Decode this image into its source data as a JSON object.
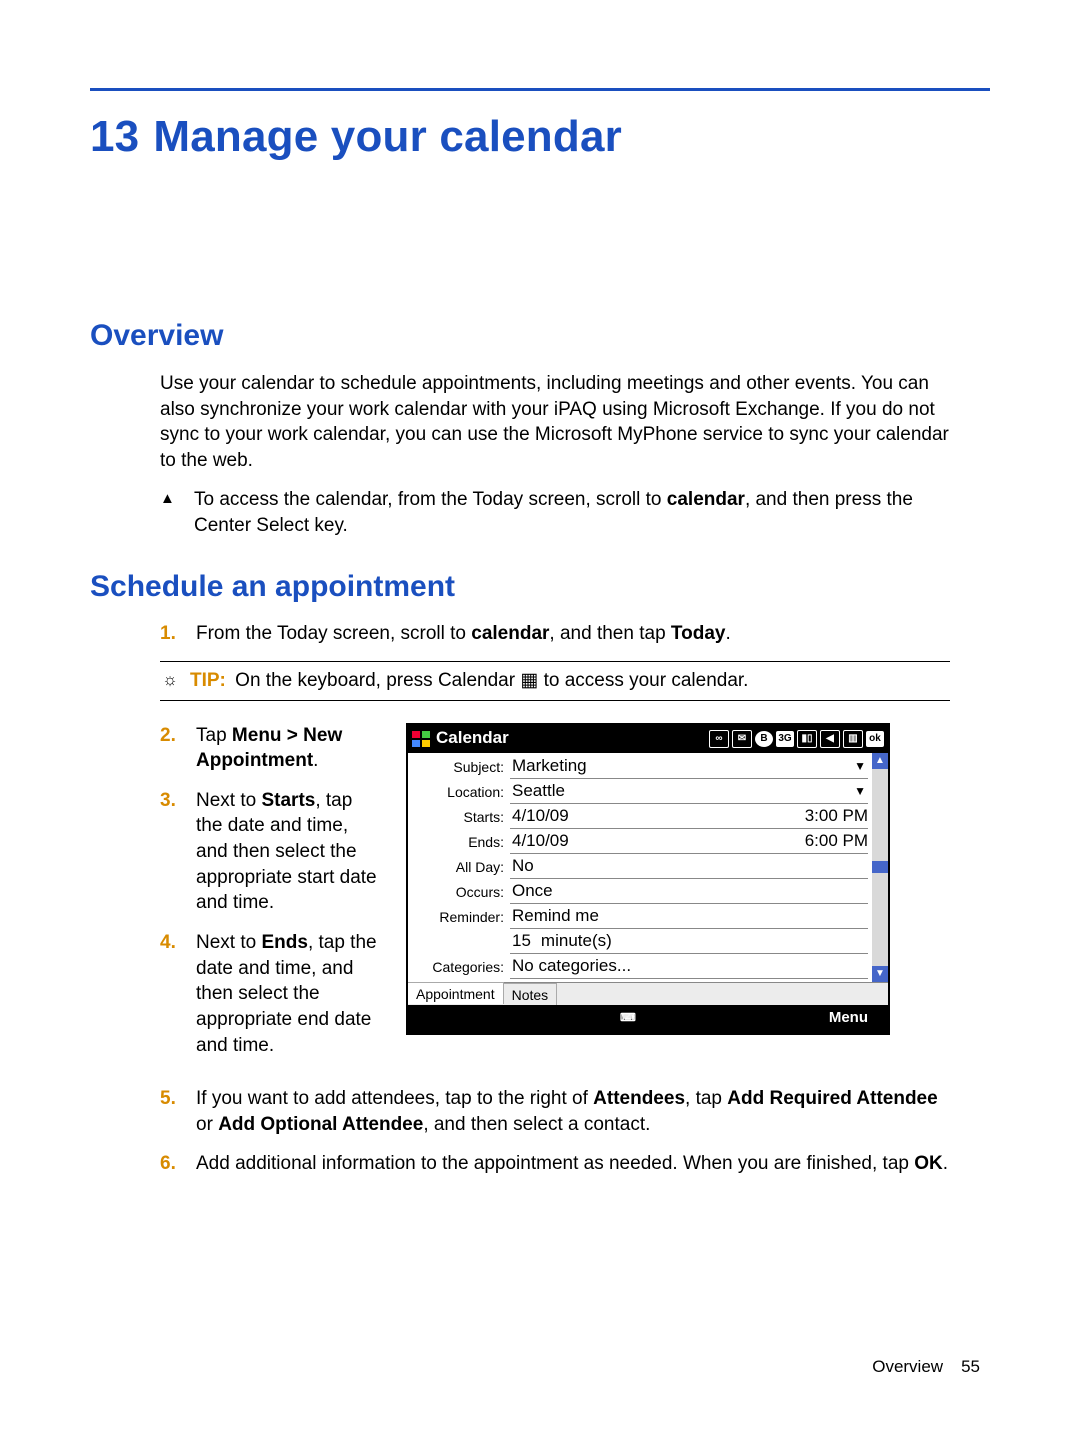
{
  "chapter": {
    "number": "13",
    "title": "Manage your calendar"
  },
  "sections": {
    "overview": {
      "heading": "Overview",
      "para": "Use your calendar to schedule appointments, including meetings and other events. You can also synchronize your work calendar with your iPAQ using Microsoft Exchange. If you do not sync to your work calendar, you can use the Microsoft MyPhone service to sync your calendar to the web.",
      "tri_before": "To access the calendar, from the Today screen, scroll to ",
      "tri_bold": "calendar",
      "tri_after": ", and then press the Center Select key."
    },
    "schedule": {
      "heading": "Schedule an appointment",
      "step1_a": "From the Today screen, scroll to ",
      "step1_b1": "calendar",
      "step1_mid": ", and then tap ",
      "step1_b2": "Today",
      "step1_end": ".",
      "tip_label": "TIP:",
      "tip_before": "On the keyboard, press Calendar ",
      "tip_after": " to access your calendar.",
      "step2_a": "Tap ",
      "step2_b": "Menu > New Appointment",
      "step2_c": ".",
      "step3_a": "Next to ",
      "step3_b": "Starts",
      "step3_c": ", tap the date and time, and then select the appropriate start date and time.",
      "step4_a": "Next to ",
      "step4_b": "Ends",
      "step4_c": ", tap the date and time, and then select the appropriate end date and time.",
      "step5_a": "If you want to add attendees, tap to the right of ",
      "step5_b1": "Attendees",
      "step5_mid1": ", tap ",
      "step5_b2": "Add Required Attendee",
      "step5_mid2": " or ",
      "step5_b3": "Add Optional Attendee",
      "step5_end": ", and then select a contact.",
      "step6_a": "Add additional information to the appointment as needed. When you are finished, tap ",
      "step6_b": "OK",
      "step6_c": "."
    }
  },
  "device": {
    "title": "Calendar",
    "tray": {
      "voicemail": "∞",
      "mail": "✉",
      "bt": "B",
      "g3": "3G",
      "signal": "▮▯",
      "vol": "◀",
      "batt": "▥",
      "ok": "ok"
    },
    "labels": {
      "subject": "Subject:",
      "location": "Location:",
      "starts": "Starts:",
      "ends": "Ends:",
      "allday": "All Day:",
      "occurs": "Occurs:",
      "reminder": "Reminder:",
      "categories": "Categories:"
    },
    "values": {
      "subject": "Marketing",
      "location": "Seattle",
      "start_date": "4/10/09",
      "start_time": "3:00 PM",
      "end_date": "4/10/09",
      "end_time": "6:00 PM",
      "allday": "No",
      "occurs": "Once",
      "reminder": "Remind me",
      "reminder_qty": "15",
      "reminder_unit": "minute(s)",
      "categories": "No categories..."
    },
    "tabs": {
      "appointment": "Appointment",
      "notes": "Notes"
    },
    "menubar": {
      "keyboard": "⌨",
      "menu": "Menu"
    }
  },
  "footer": {
    "section": "Overview",
    "page": "55"
  }
}
